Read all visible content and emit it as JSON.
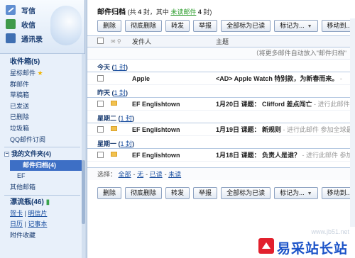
{
  "sidebar": {
    "top_items": [
      {
        "label": "写信",
        "icon": "compose-icon"
      },
      {
        "label": "收信",
        "icon": "inbox-icon"
      },
      {
        "label": "通讯录",
        "icon": "address-book-icon"
      }
    ],
    "inbox": "收件箱(5)",
    "starred": "星标邮件",
    "folders": [
      "群邮件",
      "草稿箱",
      "已发送",
      "已删除",
      "垃圾箱",
      "QQ邮件订阅"
    ],
    "my_folders": "我的文件夹(4)",
    "selected_folder": "邮件归档(4)",
    "sub_folder": "EF",
    "other": "其他邮箱",
    "drift_bottle": "漂流瓶(46)",
    "links": [
      "贺卡",
      "明信片",
      "日历",
      "记事本",
      "附件收藏"
    ]
  },
  "main": {
    "title": "邮件归档",
    "stat_prefix": "(共",
    "stat_total": "4",
    "stat_mid": "封，其中",
    "stat_unread_label": "未读邮件",
    "stat_unread": "4",
    "stat_suffix": "封)",
    "toolbar": {
      "delete": "删除",
      "delete_perm": "彻底删除",
      "forward": "转发",
      "report": "举报",
      "mark_all_read": "全部标为已读",
      "mark_as": "标记为...",
      "move_to": "移动到..."
    },
    "columns": {
      "from": "发件人",
      "subject": "主题"
    },
    "tip": "（将更多邮件自动放入\"邮件归档\"",
    "groups": [
      {
        "label": "今天",
        "count": "1 封"
      },
      {
        "label": "昨天",
        "count": "1 封"
      },
      {
        "label": "星期二",
        "count": "1 封"
      },
      {
        "label": "星期一",
        "count": "1 封"
      }
    ],
    "mails": [
      {
        "from": "Apple",
        "date": "",
        "subject": "<AD> Apple Watch 特别款，为新春而来。",
        "snippet": " -"
      },
      {
        "from": "EF Englishtown",
        "date": "1月20日",
        "subject": " 课题： Clifford 差点闯亡",
        "snippet": " - 进行此邮件 参加全"
      },
      {
        "from": "EF Englishtown",
        "date": "1月19日",
        "subject": " 课题： 新规则",
        "snippet": " - 进行此邮件 参加全球最大英"
      },
      {
        "from": "EF Englishtown",
        "date": "1月18日",
        "subject": " 课题： 负责人是谁？",
        "snippet": " - 进行此邮件 参加全球最大"
      }
    ],
    "select": {
      "prefix": "选择：",
      "all": "全部",
      "none": "无",
      "read": "已读",
      "unread": "未读",
      "dash": "-"
    }
  },
  "watermark": {
    "url": "www.jb51.net",
    "text": "易采站长站"
  }
}
